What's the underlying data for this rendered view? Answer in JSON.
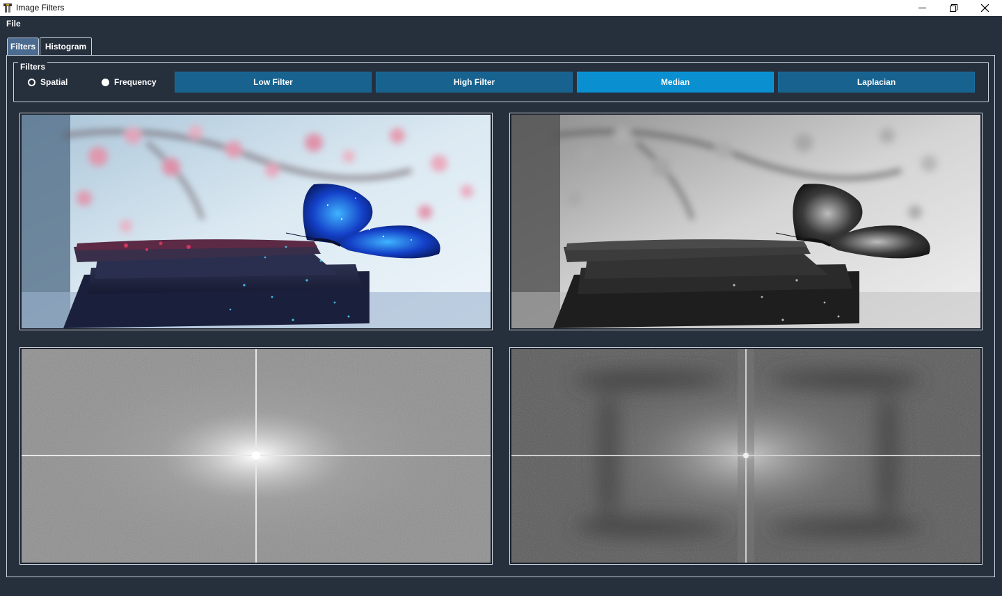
{
  "window": {
    "title": "Image Filters",
    "icon": "app-icon",
    "controls": [
      "minimize-icon",
      "restore-icon",
      "close-icon"
    ]
  },
  "menu": {
    "items": [
      "File"
    ]
  },
  "tabs": {
    "items": [
      {
        "label": "Filters",
        "selected": true
      },
      {
        "label": "Histogram",
        "selected": false
      }
    ]
  },
  "filters_group": {
    "title": "Filters",
    "domain_options": [
      {
        "label": "Spatial",
        "checked": false
      },
      {
        "label": "Frequency",
        "checked": true
      }
    ],
    "buttons": [
      {
        "label": "Low Filter",
        "active": false
      },
      {
        "label": "High Filter",
        "active": false
      },
      {
        "label": "Median",
        "active": true
      },
      {
        "label": "Laplacian",
        "active": false
      }
    ]
  },
  "colors": {
    "background": "#262f3c",
    "button": "#17628f",
    "button_active": "#0a8fd0",
    "tab_selected": "#4b6b90",
    "border": "#c8d2de"
  }
}
